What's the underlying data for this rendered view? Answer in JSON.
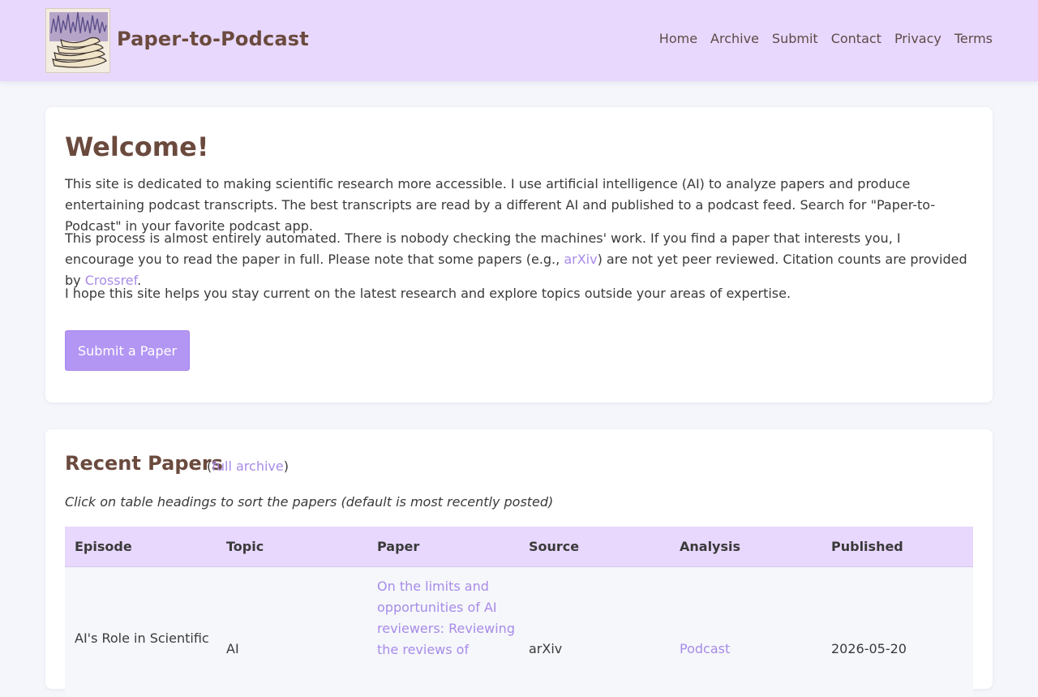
{
  "header": {
    "site_title": "Paper-to-Podcast",
    "logo_icon": "paper-stack-soundwave-logo",
    "nav": [
      "Home",
      "Archive",
      "Submit",
      "Contact",
      "Privacy",
      "Terms"
    ]
  },
  "welcome": {
    "title": "Welcome!",
    "p1": "This site is dedicated to making scientific research more accessible. I use artificial intelligence (AI) to analyze papers and produce entertaining podcast transcripts. The best transcripts are read by a different AI and published to a podcast feed. Search for \"Paper-to-Podcast\" in your favorite podcast app.",
    "p2_before": "This process is almost entirely automated. There is nobody checking the machines' work. If you find a paper that interests you, I encourage you to read the paper in full. Please note that some papers (e.g., ",
    "p2_link1": "arXiv",
    "p2_middle": ") are not yet peer reviewed. Citation counts are provided by ",
    "p2_link2": "Crossref",
    "p2_after": ".",
    "p3": "I hope this site helps you stay current on the latest research and explore topics outside your areas of expertise.",
    "submit_label": "Submit a Paper"
  },
  "recent": {
    "title": "Recent Papers",
    "paren_open": "(",
    "archive_link": "full archive",
    "paren_close": ")",
    "hint": "Click on table headings to sort the papers (default is most recently posted)",
    "columns": [
      "Episode",
      "Topic",
      "Paper",
      "Source",
      "Analysis",
      "Published"
    ],
    "rows": [
      {
        "episode": "AI's Role in Scientific",
        "topic": "AI",
        "paper_lines": [
          "On the limits and",
          "opportunities of AI",
          "reviewers: Reviewing",
          "the reviews of"
        ],
        "source": "arXiv",
        "analysis": "Podcast",
        "published": "2026-05-20"
      }
    ]
  },
  "colors": {
    "header_bg": "#e8d8fd",
    "accent": "#b396f3",
    "link": "#a98be8",
    "title_brown": "#6b4a3e",
    "page_bg": "#f4f6fb"
  }
}
